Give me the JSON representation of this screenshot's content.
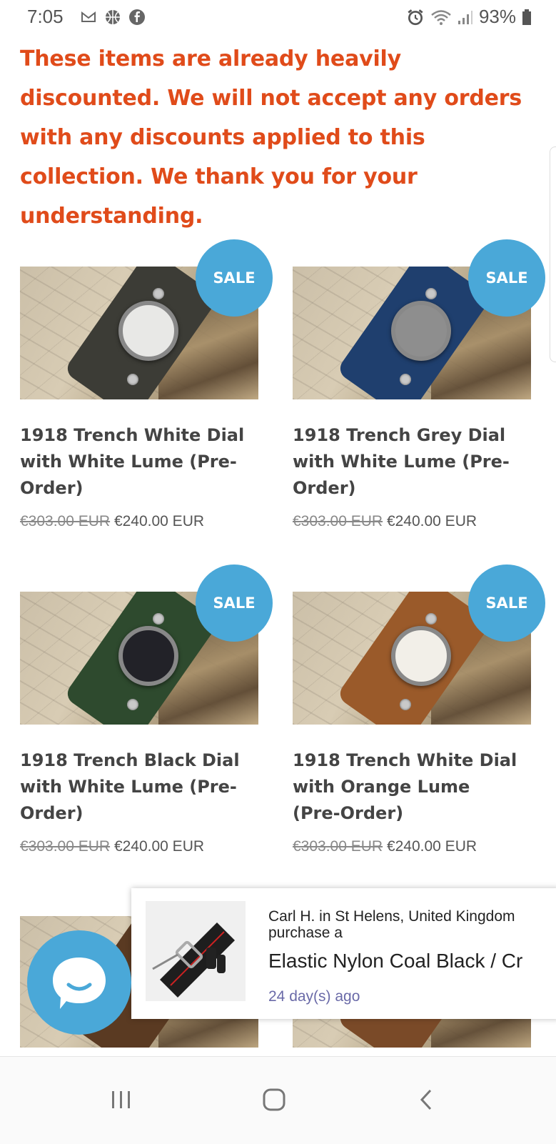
{
  "status_bar": {
    "time": "7:05",
    "battery": "93%",
    "left_icons": [
      "gmail-icon",
      "basketball-icon",
      "facebook-icon"
    ],
    "right_icons": [
      "alarm-icon",
      "wifi-icon",
      "signal-icon",
      "battery-icon"
    ]
  },
  "notice": {
    "text": "These items are already heavily discounted. We will not accept any orders with any discounts applied to this collection. We thank you for your understanding.",
    "color": "#e04b1a"
  },
  "sale_badge_label": "SALE",
  "products": [
    {
      "title": "1918 Trench White Dial with White Lume (Pre-Order)",
      "old_price": "€303.00 EUR",
      "price": "€240.00 EUR",
      "strap_color": "#3c3c36",
      "dial_color": "#e8e8e6"
    },
    {
      "title": "1918 Trench Grey Dial with White Lume (Pre-Order)",
      "old_price": "€303.00 EUR",
      "price": "€240.00 EUR",
      "strap_color": "#1f3f6e",
      "dial_color": "#8e8e8e"
    },
    {
      "title": "1918 Trench Black Dial with White Lume (Pre-Order)",
      "old_price": "€303.00 EUR",
      "price": "€240.00 EUR",
      "strap_color": "#2e4a2e",
      "dial_color": "#222228"
    },
    {
      "title": "1918 Trench White Dial with Orange Lume (Pre-Order)",
      "old_price": "€303.00 EUR",
      "price": "€240.00 EUR",
      "strap_color": "#9a5a2a",
      "dial_color": "#f2efe8"
    }
  ],
  "recent_purchase": {
    "line1": "Carl H. in St Helens, United Kingdom",
    "line2": "purchase a",
    "product": "Elastic Nylon Coal Black / Cr",
    "time_ago": "24 day(s) ago"
  },
  "colors": {
    "accent": "#4aa8d8",
    "notice": "#e04b1a"
  },
  "nav_icons": [
    "recent-apps-icon",
    "home-icon",
    "back-icon"
  ]
}
